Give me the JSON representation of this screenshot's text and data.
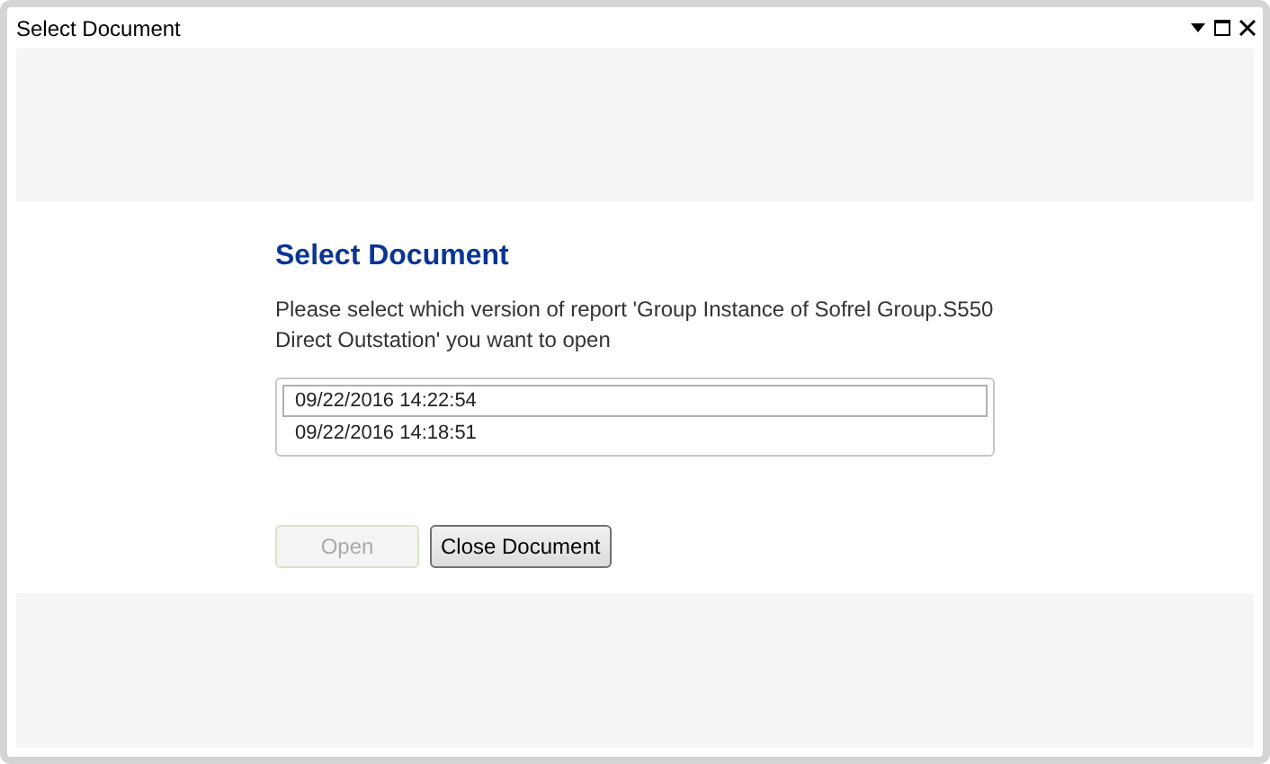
{
  "window": {
    "title": "Select Document"
  },
  "dialog": {
    "heading": "Select Document",
    "message": "Please select which version of report 'Group Instance of Sofrel Group.S550 Direct Outstation' you want to open",
    "versions": [
      {
        "label": "09/22/2016 14:22:54",
        "selected": true
      },
      {
        "label": "09/22/2016 14:18:51",
        "selected": false
      }
    ],
    "buttons": [
      {
        "label": "Open",
        "disabled": true
      },
      {
        "label": "Close Document",
        "disabled": false
      }
    ]
  }
}
